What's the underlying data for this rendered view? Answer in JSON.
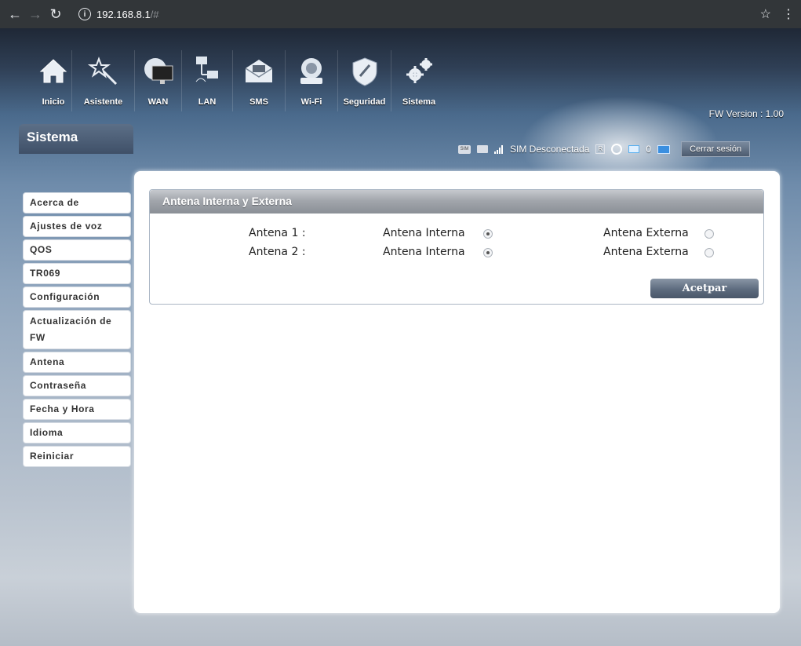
{
  "browser": {
    "url_host": "192.168.8.1",
    "url_path": "/#"
  },
  "topnav": [
    {
      "id": "inicio",
      "label": "Inicio",
      "icon": "home-icon"
    },
    {
      "id": "asistente",
      "label": "Asistente",
      "icon": "wizard-wand-icon"
    },
    {
      "id": "wan",
      "label": "WAN",
      "icon": "globe-monitor-icon"
    },
    {
      "id": "lan",
      "label": "LAN",
      "icon": "network-computers-icon"
    },
    {
      "id": "sms",
      "label": "SMS",
      "icon": "envelope-icon"
    },
    {
      "id": "wifi",
      "label": "Wi-Fi",
      "icon": "wifi-router-icon"
    },
    {
      "id": "seguridad",
      "label": "Seguridad",
      "icon": "shield-icon"
    },
    {
      "id": "sistema",
      "label": "Sistema",
      "icon": "gears-icon"
    }
  ],
  "fw_version": "FW Version : 1.00",
  "sidebar": {
    "title": "Sistema",
    "items": [
      {
        "label": "Acerca de"
      },
      {
        "label": "Ajustes de voz"
      },
      {
        "label": "QOS"
      },
      {
        "label": "TR069"
      },
      {
        "label": "Configuración"
      },
      {
        "label": "Actualización de FW"
      },
      {
        "label": "Antena"
      },
      {
        "label": "Contraseña"
      },
      {
        "label": "Fecha y Hora"
      },
      {
        "label": "Idioma"
      },
      {
        "label": "Reiniciar"
      }
    ]
  },
  "status": {
    "sim_icon_text": "SIM",
    "sim_status": "SIM Desconectada",
    "roaming_label": "R",
    "clients_count": "0",
    "logout_label": "Cerrar sesión"
  },
  "panel": {
    "title": "Antena Interna y Externa",
    "rows": [
      {
        "label": "Antena 1 :",
        "option_internal": "Antena Interna",
        "option_external": "Antena Externa",
        "selected": "internal"
      },
      {
        "label": "Antena 2 :",
        "option_internal": "Antena Interna",
        "option_external": "Antena Externa",
        "selected": "internal"
      }
    ],
    "accept_label": "Acetpar"
  }
}
